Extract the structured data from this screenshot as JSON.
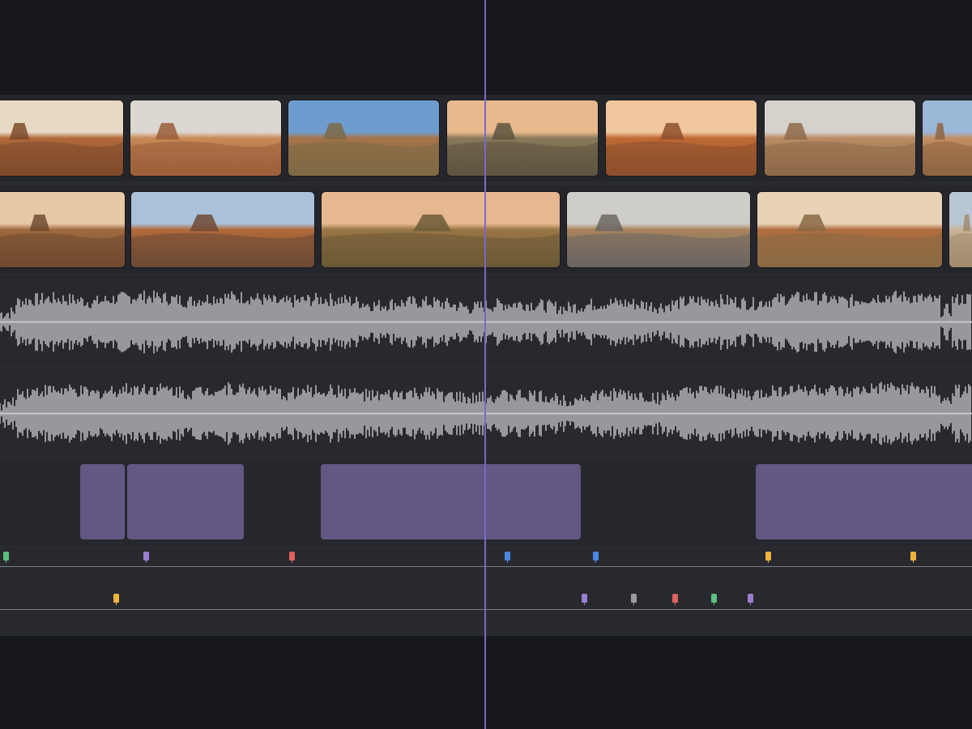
{
  "timeline": {
    "name": "video-timeline",
    "playhead_color": "#7b68c9"
  },
  "video_track_1": {
    "clips": [
      {
        "name": "clip-desert-buttes",
        "palette": [
          "#e8d9c4",
          "#b26a3c",
          "#7d4a2c"
        ]
      },
      {
        "name": "clip-desert-valley",
        "palette": [
          "#dcd7d0",
          "#c98a57",
          "#9b5e3a"
        ]
      },
      {
        "name": "clip-road-blue-sky",
        "palette": [
          "#6f9ccf",
          "#a7744a",
          "#7e6a46"
        ]
      },
      {
        "name": "clip-road-sunset",
        "palette": [
          "#e8b98c",
          "#8a7a5a",
          "#5e543f"
        ]
      },
      {
        "name": "clip-rock-formation",
        "palette": [
          "#f1c79d",
          "#c06a35",
          "#8d4f2c"
        ]
      },
      {
        "name": "clip-aerial-road",
        "palette": [
          "#d5d2cc",
          "#b98c64",
          "#8e6a49"
        ]
      },
      {
        "name": "clip-desert-edge",
        "palette": [
          "#9ab7d8",
          "#c48e62",
          "#8e6542"
        ]
      }
    ]
  },
  "video_track_2": {
    "clips": [
      {
        "name": "clip-mesa-dusk",
        "palette": [
          "#e7c8a5",
          "#a06a3f",
          "#6f4a30"
        ]
      },
      {
        "name": "clip-red-butte",
        "palette": [
          "#a9c1d9",
          "#b2693a",
          "#6e4a34"
        ]
      },
      {
        "name": "clip-grassland",
        "palette": [
          "#e6b890",
          "#9a7545",
          "#6b5a36"
        ]
      },
      {
        "name": "clip-cracked-road",
        "palette": [
          "#cfcdc8",
          "#a9845d",
          "#6b6660"
        ]
      },
      {
        "name": "clip-lone-butte",
        "palette": [
          "#e8d2b8",
          "#b16d40",
          "#8a6a44"
        ]
      },
      {
        "name": "clip-partial",
        "palette": [
          "#b9c7d4",
          "#c9b39a",
          "#a38b70"
        ]
      }
    ]
  },
  "audio_tracks": [
    {
      "name": "audio-track-1",
      "color": "#c7c8cc"
    },
    {
      "name": "audio-track-2",
      "color": "#c7c8cc"
    }
  ],
  "title_track": {
    "clip_color": "#625883"
  },
  "marker_rows": [
    {
      "markers": [
        {
          "color": "#5fbf80",
          "name": "marker-green"
        },
        {
          "color": "#9a7fd1",
          "name": "marker-purple"
        },
        {
          "color": "#e0625d",
          "name": "marker-red"
        },
        {
          "color": "#4a86e0",
          "name": "marker-blue"
        },
        {
          "color": "#4a86e0",
          "name": "marker-blue"
        },
        {
          "color": "#f0b43c",
          "name": "marker-yellow"
        },
        {
          "color": "#f0b43c",
          "name": "marker-yellow"
        }
      ]
    },
    {
      "markers": [
        {
          "color": "#f0b43c",
          "name": "marker-yellow"
        },
        {
          "color": "#9a7fd1",
          "name": "marker-purple"
        },
        {
          "color": "#9a9c9f",
          "name": "marker-gray"
        },
        {
          "color": "#e0625d",
          "name": "marker-red"
        },
        {
          "color": "#5fbf80",
          "name": "marker-green"
        },
        {
          "color": "#9a7fd1",
          "name": "marker-purple"
        }
      ]
    }
  ]
}
